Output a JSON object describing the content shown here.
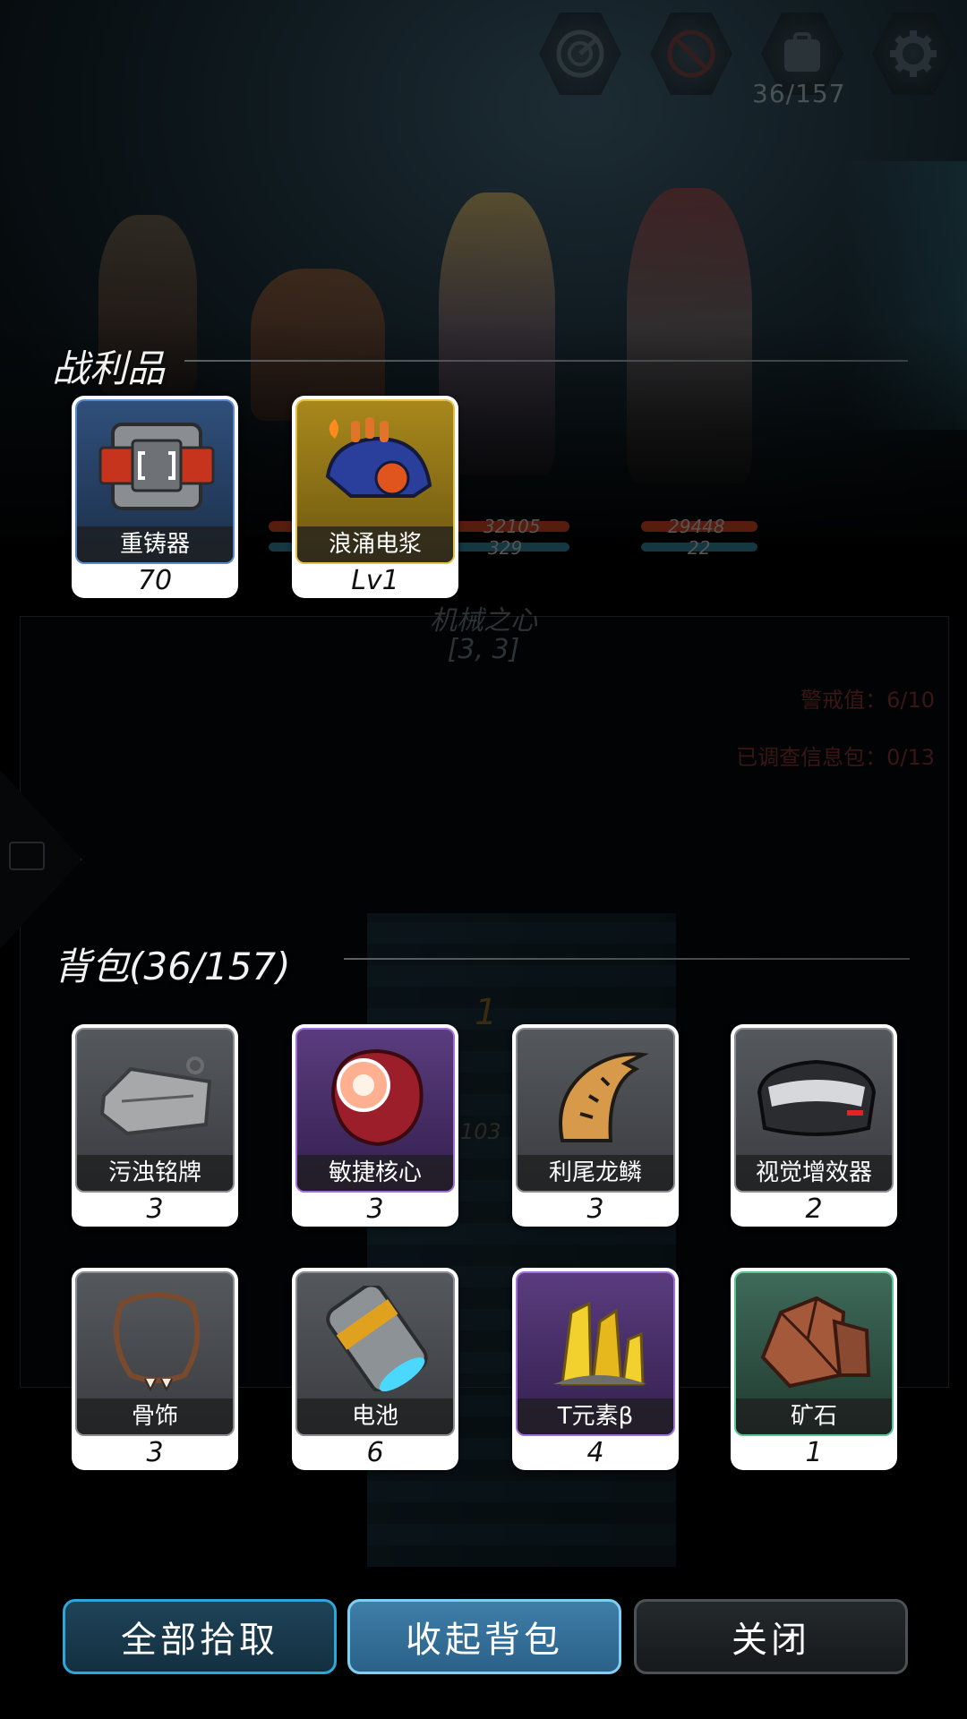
{
  "hud": {
    "backpack_count": "36/157",
    "icons": [
      "radar-icon",
      "forbidden-icon",
      "backpack-icon",
      "settings-gear-icon"
    ]
  },
  "battle": {
    "units": [
      {
        "hp": "32105",
        "mp": "329"
      },
      {
        "hp": "29448",
        "mp": "22"
      }
    ]
  },
  "map": {
    "node_name": "机械之心",
    "node_coord": "[3, 3]",
    "alert": "警戒值：6/10",
    "investigated": "已调查信息包：0/13",
    "marker_number": "1",
    "marker_value": "103"
  },
  "loot": {
    "title": "战利品",
    "items": [
      {
        "name": "重铸器",
        "count": "70",
        "rarity": "blue",
        "icon": "reforger-icon"
      },
      {
        "name": "浪涌电浆",
        "count": "Lv1",
        "rarity": "gold",
        "icon": "surge-plasma-icon"
      }
    ]
  },
  "backpack": {
    "title": "背包(36/157)",
    "items": [
      {
        "name": "污浊铭牌",
        "count": "3",
        "rarity": "grey",
        "icon": "dog-tag-icon"
      },
      {
        "name": "敏捷核心",
        "count": "3",
        "rarity": "purple",
        "icon": "agility-core-icon"
      },
      {
        "name": "利尾龙鳞",
        "count": "3",
        "rarity": "grey",
        "icon": "dragon-scale-icon"
      },
      {
        "name": "视觉增效器",
        "count": "2",
        "rarity": "grey",
        "icon": "visor-icon"
      },
      {
        "name": "骨饰",
        "count": "3",
        "rarity": "grey",
        "icon": "bone-necklace-icon"
      },
      {
        "name": "电池",
        "count": "6",
        "rarity": "grey",
        "icon": "battery-icon"
      },
      {
        "name": "T元素β",
        "count": "4",
        "rarity": "purple",
        "icon": "crystal-icon"
      },
      {
        "name": "矿石",
        "count": "1",
        "rarity": "green",
        "icon": "ore-icon"
      }
    ]
  },
  "buttons": {
    "pick_all": "全部拾取",
    "fold_bag": "收起背包",
    "close": "关闭"
  },
  "colors": {
    "pick_border": "#2fa6d8",
    "fold_bg": "#3f7ea8",
    "rarity_blue": "#5c88c6",
    "rarity_gold": "#e0c04a",
    "rarity_purple": "#a070d8",
    "rarity_green": "#5cc596"
  }
}
